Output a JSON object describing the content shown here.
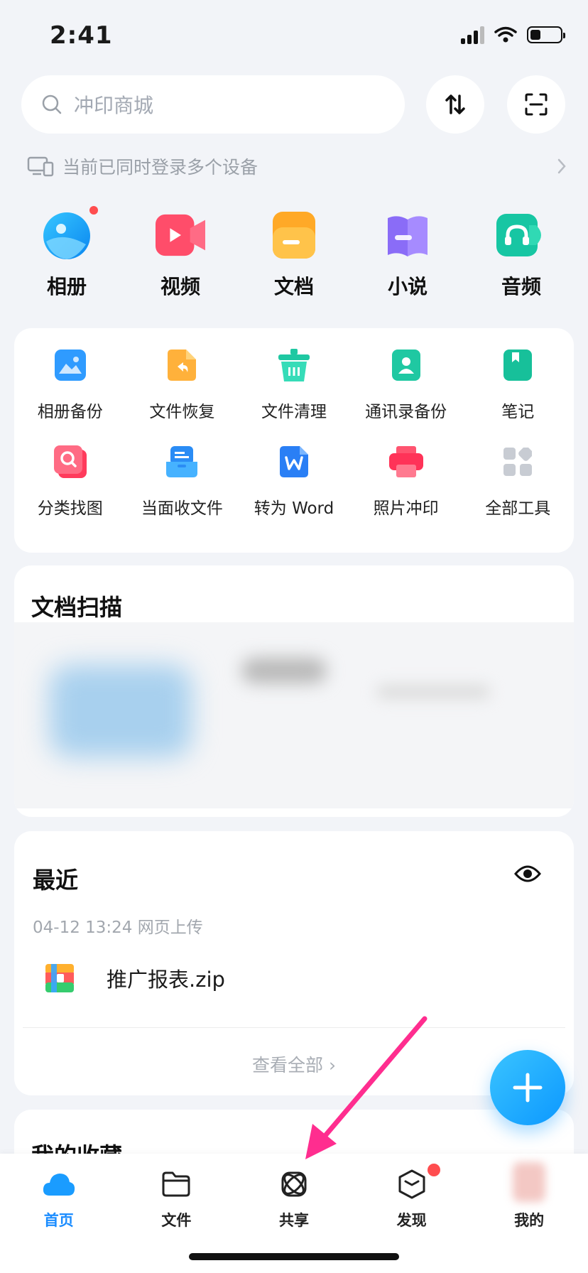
{
  "status_bar": {
    "time": "2:41"
  },
  "search": {
    "placeholder": "冲印商城"
  },
  "device_notice": {
    "text": "当前已同时登录多个设备"
  },
  "categories": [
    {
      "label": "相册",
      "icon": "photo-album-icon"
    },
    {
      "label": "视频",
      "icon": "video-icon"
    },
    {
      "label": "文档",
      "icon": "document-icon"
    },
    {
      "label": "小说",
      "icon": "novel-icon"
    },
    {
      "label": "音频",
      "icon": "audio-icon"
    }
  ],
  "tools": [
    {
      "label": "相册备份",
      "icon": "album-backup-icon"
    },
    {
      "label": "文件恢复",
      "icon": "file-restore-icon"
    },
    {
      "label": "文件清理",
      "icon": "file-clean-icon"
    },
    {
      "label": "通讯录备份",
      "icon": "contacts-backup-icon"
    },
    {
      "label": "笔记",
      "icon": "notes-icon"
    },
    {
      "label": "分类找图",
      "icon": "image-search-icon"
    },
    {
      "label": "当面收文件",
      "icon": "receive-files-icon"
    },
    {
      "label": "转为 Word",
      "icon": "convert-word-icon"
    },
    {
      "label": "照片冲印",
      "icon": "photo-print-icon"
    },
    {
      "label": "全部工具",
      "icon": "all-tools-icon"
    }
  ],
  "doc_scan": {
    "title": "文档扫描"
  },
  "recent": {
    "title": "最近",
    "meta": "04-12 13:24 网页上传",
    "file_name": "推广报表.zip",
    "view_all": "查看全部 ›"
  },
  "favorites": {
    "title": "我的收藏"
  },
  "nav": [
    {
      "label": "首页",
      "active": true
    },
    {
      "label": "文件",
      "active": false
    },
    {
      "label": "共享",
      "active": false
    },
    {
      "label": "发现",
      "active": false
    },
    {
      "label": "我的",
      "active": false
    }
  ],
  "colors": {
    "accent": "#1a8cff",
    "annotation_arrow": "#ff2d8f",
    "badge_red": "#ff4d4f"
  }
}
